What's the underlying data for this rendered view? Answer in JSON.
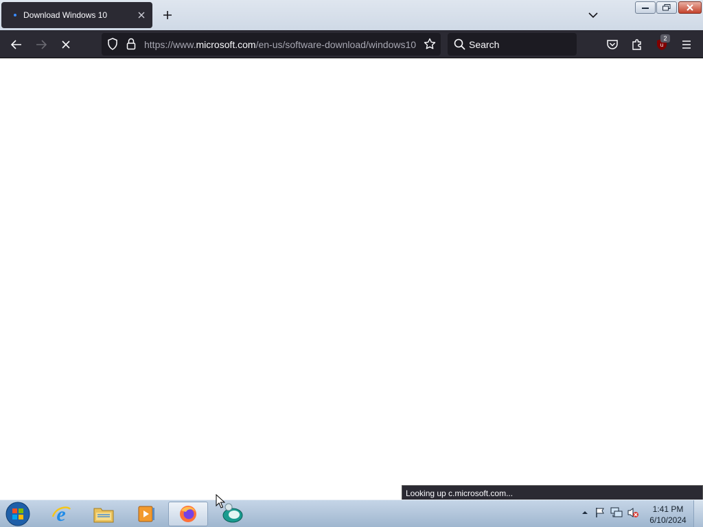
{
  "browser": {
    "tab": {
      "title": "Download Windows 10",
      "loading_dot_color": "#3a8cff"
    },
    "new_tab_icon": "plus-icon",
    "url": {
      "prefix": "https://www.",
      "domain": "microsoft.com",
      "path": "/en-us/software-download/windows10"
    },
    "search_placeholder": "Search",
    "extensions_badge": "2",
    "status_text": "Looking up c.microsoft.com..."
  },
  "taskbar": {
    "items": [
      "start-orb",
      "internet-explorer",
      "windows-explorer",
      "media-player",
      "firefox",
      "app-globe"
    ],
    "clock": {
      "time": "1:41 PM",
      "date": "6/10/2024"
    }
  },
  "colors": {
    "toolbar": "#2b2a33",
    "urlbar": "#1c1b22",
    "taskbar": "#9fb6cf"
  }
}
